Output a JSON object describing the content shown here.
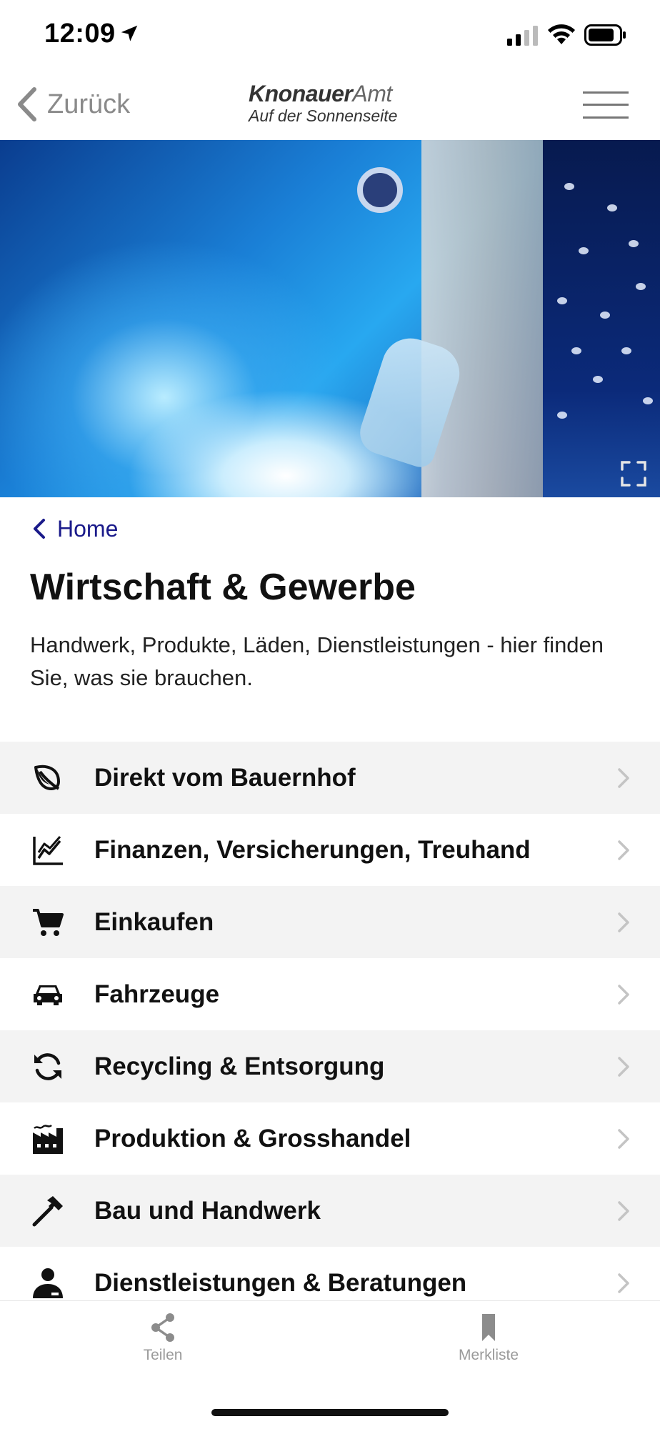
{
  "status_bar": {
    "time": "12:09",
    "icons": [
      "location-arrow-icon",
      "cellular-signal-icon",
      "wifi-icon",
      "battery-icon"
    ]
  },
  "nav": {
    "back_label": "Zurück",
    "logo_part1": "Knonauer",
    "logo_part2": "Amt",
    "logo_tagline": "Auf der Sonnenseite",
    "menu_icon": "hamburger-menu-icon"
  },
  "hero": {
    "fullscreen_icon": "fullscreen-icon"
  },
  "breadcrumb": {
    "label": "Home"
  },
  "page": {
    "title": "Wirtschaft & Gewerbe",
    "description": "Handwerk, Produkte, Läden, Dienstleistungen - hier finden Sie, was sie brauchen."
  },
  "categories": [
    {
      "label": "Direkt vom Bauernhof",
      "icon": "leaf-icon"
    },
    {
      "label": "Finanzen, Versicherungen, Treuhand",
      "icon": "chart-line-icon"
    },
    {
      "label": "Einkaufen",
      "icon": "shopping-cart-icon"
    },
    {
      "label": "Fahrzeuge",
      "icon": "car-icon"
    },
    {
      "label": "Recycling & Entsorgung",
      "icon": "recycle-icon"
    },
    {
      "label": "Produktion & Grosshandel",
      "icon": "factory-icon"
    },
    {
      "label": "Bau und Handwerk",
      "icon": "hammer-icon"
    },
    {
      "label": "Dienstleistungen & Beratungen",
      "icon": "person-icon"
    }
  ],
  "bottom_bar": {
    "share_label": "Teilen",
    "bookmark_label": "Merkliste"
  },
  "colors": {
    "link": "#1a1a8a",
    "shaded_row": "#f3f3f3",
    "muted": "#9a9a9a"
  }
}
